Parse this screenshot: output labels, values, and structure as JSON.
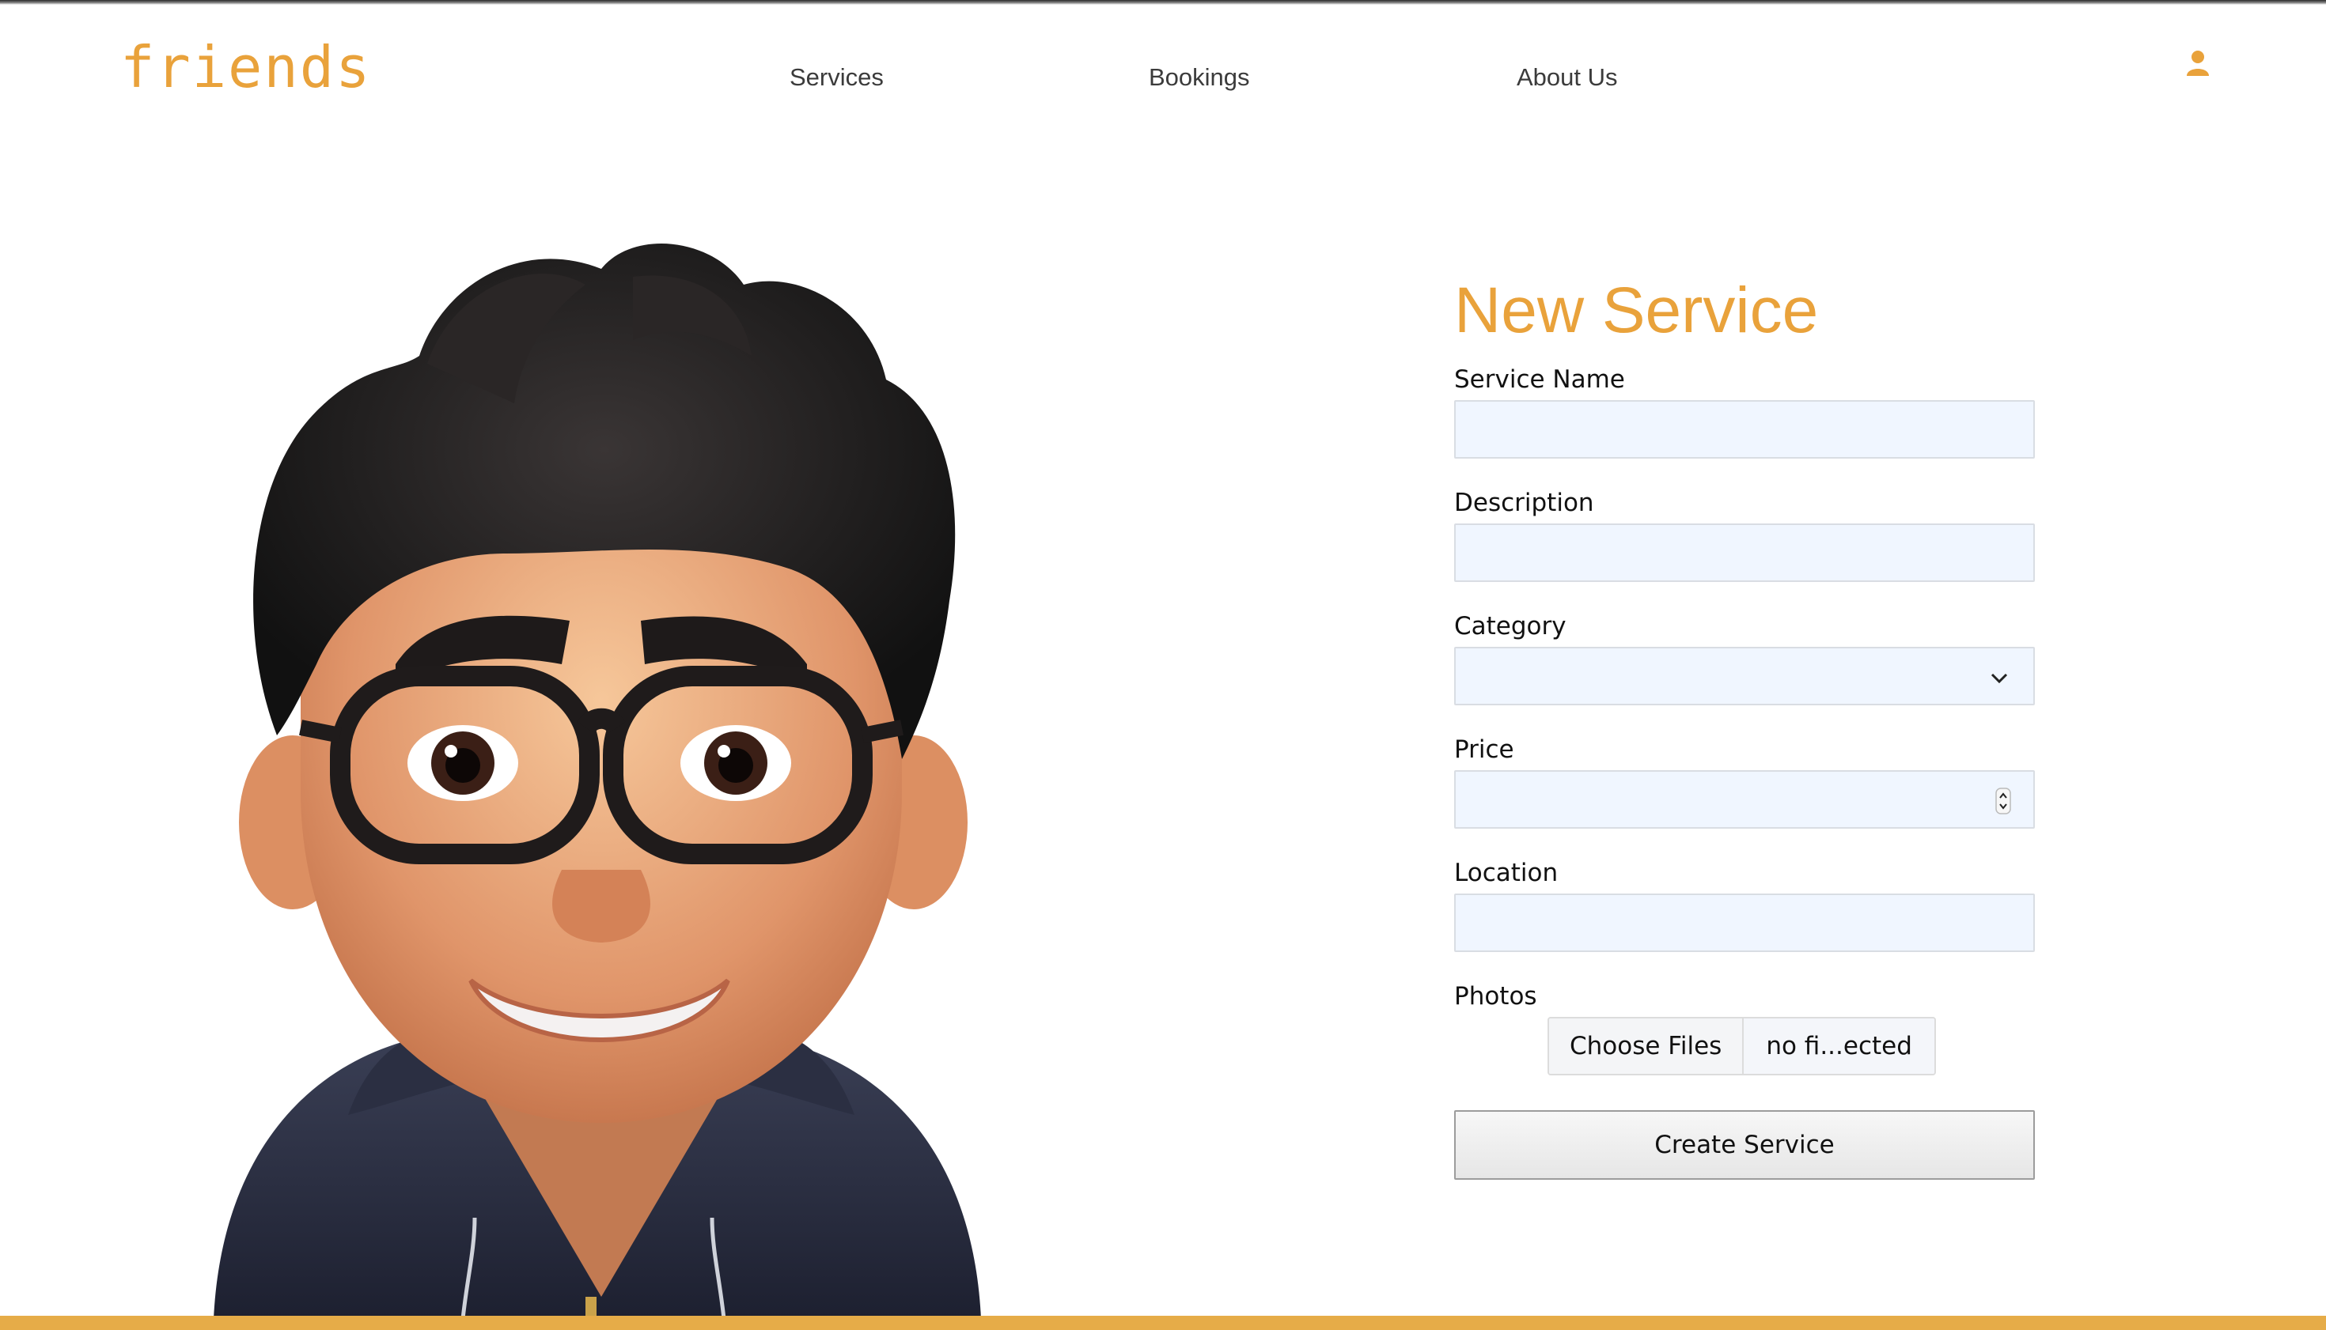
{
  "header": {
    "logo": "friends",
    "nav": [
      "Services",
      "Bookings",
      "About Us"
    ]
  },
  "form": {
    "title": "New Service",
    "fields": [
      {
        "label": "Service Name",
        "value": ""
      },
      {
        "label": "Description",
        "value": ""
      },
      {
        "label": "Category",
        "value": ""
      },
      {
        "label": "Price",
        "value": ""
      },
      {
        "label": "Location",
        "value": ""
      }
    ],
    "photos_label": "Photos",
    "choose_files": "Choose Files",
    "file_status": "no fi...ected",
    "submit": "Create Service"
  },
  "colors": {
    "accent": "#e9a23b",
    "field_bg": "#f0f6ff",
    "bottom_bar": "#e6ac48"
  }
}
